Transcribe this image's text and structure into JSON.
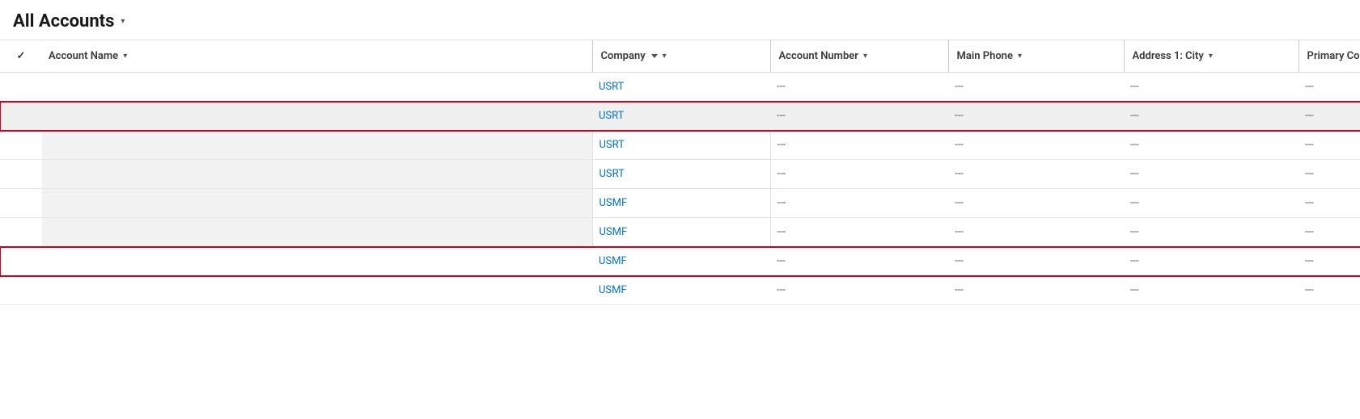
{
  "header": {
    "title": "All Accounts",
    "chevron": "▾"
  },
  "table": {
    "columns": [
      {
        "id": "check",
        "label": "✓",
        "sortable": false
      },
      {
        "id": "account_name",
        "label": "Account Name",
        "sortable": true,
        "has_border": false
      },
      {
        "id": "company",
        "label": "Company",
        "sortable": true,
        "sort_dir": "desc",
        "has_border": true
      },
      {
        "id": "account_number",
        "label": "Account Number",
        "sortable": true,
        "has_border": true
      },
      {
        "id": "main_phone",
        "label": "Main Phone",
        "sortable": true,
        "has_border": true
      },
      {
        "id": "address_city",
        "label": "Address 1: City",
        "sortable": true,
        "has_border": true
      },
      {
        "id": "primary_contact",
        "label": "Primary Contact",
        "sortable": true,
        "has_border": true
      }
    ],
    "rows": [
      {
        "id": 1,
        "account_name": "",
        "company": "USRT",
        "account_number": "---",
        "main_phone": "---",
        "address_city": "---",
        "primary_contact": "---",
        "highlight": false,
        "red_border": false,
        "obscured": false
      },
      {
        "id": 2,
        "account_name": "",
        "company": "USRT",
        "account_number": "---",
        "main_phone": "---",
        "address_city": "---",
        "primary_contact": "---",
        "highlight": true,
        "red_border": false,
        "obscured": false
      },
      {
        "id": 3,
        "account_name": "",
        "company": "USRT",
        "account_number": "---",
        "main_phone": "---",
        "address_city": "---",
        "primary_contact": "---",
        "highlight": false,
        "red_border": false,
        "obscured": true
      },
      {
        "id": 4,
        "account_name": "",
        "company": "USRT",
        "account_number": "---",
        "main_phone": "---",
        "address_city": "---",
        "primary_contact": "---",
        "highlight": false,
        "red_border": false,
        "obscured": true
      },
      {
        "id": 5,
        "account_name": "",
        "company": "USMF",
        "account_number": "---",
        "main_phone": "---",
        "address_city": "---",
        "primary_contact": "---",
        "highlight": false,
        "red_border": false,
        "obscured": true
      },
      {
        "id": 6,
        "account_name": "",
        "company": "USMF",
        "account_number": "---",
        "main_phone": "---",
        "address_city": "---",
        "primary_contact": "---",
        "highlight": false,
        "red_border": false,
        "obscured": true
      },
      {
        "id": 7,
        "account_name": "",
        "company": "USMF",
        "account_number": "---",
        "main_phone": "---",
        "address_city": "",
        "primary_contact": "---",
        "highlight": false,
        "red_border": true,
        "obscured": false
      },
      {
        "id": 8,
        "account_name": "",
        "company": "USMF",
        "account_number": "---",
        "main_phone": "---",
        "address_city": "",
        "primary_contact": "---",
        "highlight": false,
        "red_border": false,
        "obscured": false
      }
    ],
    "dash": "---"
  }
}
